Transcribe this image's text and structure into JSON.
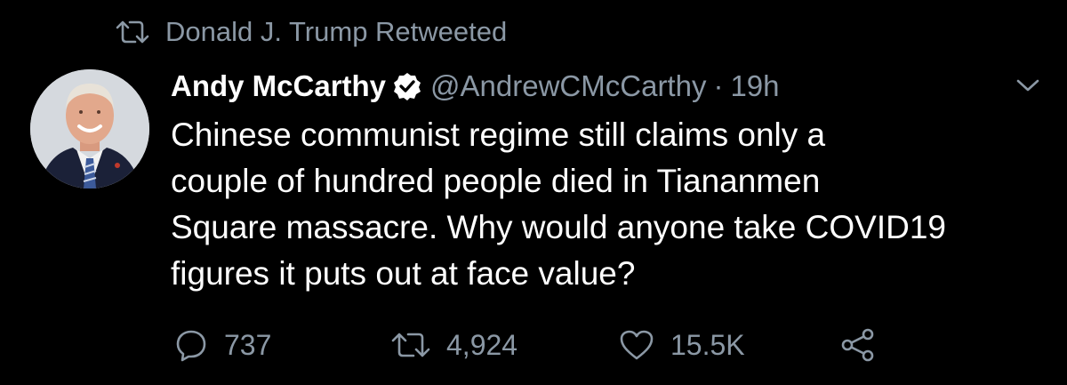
{
  "retweet_header": {
    "icon": "retweet-icon",
    "text": "Donald J. Trump Retweeted"
  },
  "tweet": {
    "display_name": "Andy McCarthy",
    "verified_icon": "verified-badge-icon",
    "handle": "@AndrewCMcCarthy",
    "separator": "·",
    "time": "19h",
    "menu_icon": "chevron-down-icon",
    "text_lines": [
      "Chinese communist regime still claims only a",
      "couple of hundred people died in Tiananmen",
      "Square massacre. Why would anyone take COVID19",
      "figures it puts out at face value?"
    ]
  },
  "actions": {
    "reply": {
      "icon": "reply-icon",
      "count": "737"
    },
    "retweet": {
      "icon": "retweet-icon",
      "count": "4,924"
    },
    "like": {
      "icon": "heart-icon",
      "count": "15.5K"
    },
    "share": {
      "icon": "share-icon"
    }
  },
  "colors": {
    "background": "#000000",
    "text_primary": "#ffffff",
    "text_secondary": "#8b98a5"
  }
}
